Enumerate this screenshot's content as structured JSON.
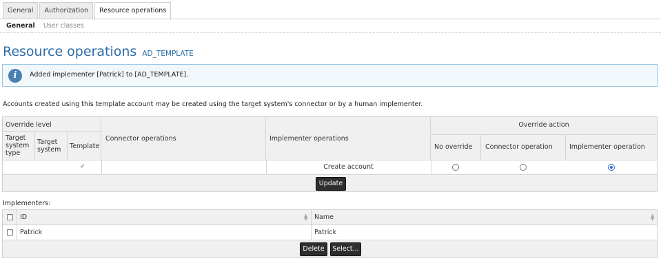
{
  "tabs": [
    {
      "label": "General"
    },
    {
      "label": "Authorization"
    },
    {
      "label": "Resource operations"
    }
  ],
  "subtabs": [
    {
      "label": "General"
    },
    {
      "label": "User classes"
    }
  ],
  "page": {
    "title": "Resource operations",
    "subtitle": "AD_TEMPLATE"
  },
  "info": {
    "icon": "info-icon",
    "message": "Added implementer [Patrick] to [AD_TEMPLATE]."
  },
  "description": "Accounts created using this template account may be created using the target system's connector or by a human implementer.",
  "operations_table": {
    "override_level": "Override level",
    "target_system_type": "Target system type",
    "target_system": "Target system",
    "template": "Template",
    "connector_operations": "Connector operations",
    "implementer_operations": "Implementer operations",
    "override_action": "Override action",
    "no_override": "No override",
    "connector_operation": "Connector operation",
    "implementer_operation": "Implementer operation",
    "rows": [
      {
        "template_check": "✔",
        "connector_operations": "",
        "implementer_operations": "Create account",
        "selected_action": "Implementer operation"
      }
    ],
    "update_button": "Update"
  },
  "implementers": {
    "label": "Implementers:",
    "columns": [
      "ID",
      "Name"
    ],
    "rows": [
      {
        "id": "Patrick",
        "name": "Patrick"
      }
    ],
    "delete_button": "Delete",
    "select_button": "Select..."
  }
}
